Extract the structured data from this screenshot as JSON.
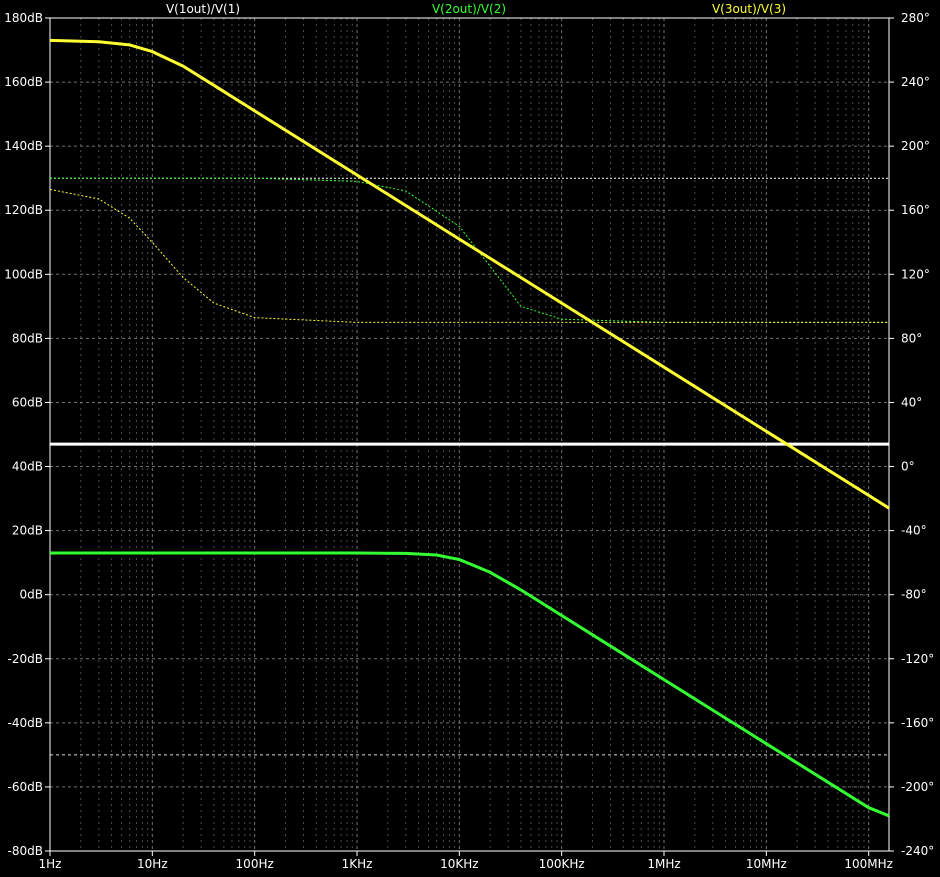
{
  "chart_data": {
    "type": "line",
    "x_scale": "log",
    "x_axis": {
      "range_hz": [
        1,
        158000000
      ],
      "ticks": [
        {
          "value": 1,
          "label": "1Hz"
        },
        {
          "value": 10,
          "label": "10Hz"
        },
        {
          "value": 100,
          "label": "100Hz"
        },
        {
          "value": 1000,
          "label": "1KHz"
        },
        {
          "value": 10000,
          "label": "10KHz"
        },
        {
          "value": 100000,
          "label": "100KHz"
        },
        {
          "value": 1000000,
          "label": "1MHz"
        },
        {
          "value": 10000000,
          "label": "10MHz"
        },
        {
          "value": 100000000,
          "label": "100MHz"
        }
      ]
    },
    "y_left": {
      "range": [
        -80,
        180
      ],
      "ticks": [
        {
          "value": 180,
          "label": "180dB"
        },
        {
          "value": 160,
          "label": "160dB"
        },
        {
          "value": 140,
          "label": "140dB"
        },
        {
          "value": 120,
          "label": "120dB"
        },
        {
          "value": 100,
          "label": "100dB"
        },
        {
          "value": 80,
          "label": "80dB"
        },
        {
          "value": 60,
          "label": "60dB"
        },
        {
          "value": 40,
          "label": "40dB"
        },
        {
          "value": 20,
          "label": "20dB"
        },
        {
          "value": 0,
          "label": "0dB"
        },
        {
          "value": -20,
          "label": "-20dB"
        },
        {
          "value": -40,
          "label": "-40dB"
        },
        {
          "value": -60,
          "label": "-60dB"
        },
        {
          "value": -80,
          "label": "-80dB"
        }
      ]
    },
    "y_right": {
      "range": [
        -240,
        280
      ],
      "ticks": [
        {
          "value": 280,
          "label": "280°"
        },
        {
          "value": 240,
          "label": "240°"
        },
        {
          "value": 200,
          "label": "200°"
        },
        {
          "value": 160,
          "label": "160°"
        },
        {
          "value": 120,
          "label": "120°"
        },
        {
          "value": 80,
          "label": "80°"
        },
        {
          "value": 40,
          "label": "40°"
        },
        {
          "value": 0,
          "label": "0°"
        },
        {
          "value": -40,
          "label": "-40°"
        },
        {
          "value": -80,
          "label": "-80°"
        },
        {
          "value": -120,
          "label": "-120°"
        },
        {
          "value": -160,
          "label": "-160°"
        },
        {
          "value": -200,
          "label": "-200°"
        },
        {
          "value": -240,
          "label": "-240°"
        }
      ]
    },
    "grid": true,
    "colors": {
      "background": "#000000",
      "grid": "#7f7f7f",
      "axis": "#ffffff",
      "trace1": "#ffffff",
      "trace2": "#33ff33",
      "trace3": "#ffff33"
    },
    "series": [
      {
        "name": "V(1out)/V(1)",
        "color": "#ffffff",
        "magnitude_db": [
          [
            1,
            47
          ],
          [
            158000000,
            47
          ]
        ],
        "phase_deg": [
          [
            1,
            180
          ],
          [
            158000000,
            180
          ]
        ]
      },
      {
        "name": "V(2out)/V(2)",
        "color": "#33ff33",
        "magnitude_db": [
          [
            1,
            13
          ],
          [
            1000,
            13
          ],
          [
            3000,
            12.9
          ],
          [
            6000,
            12.4
          ],
          [
            10000,
            11
          ],
          [
            20000,
            7
          ],
          [
            40000,
            1.5
          ],
          [
            100000,
            -6.5
          ],
          [
            1000000,
            -26.5
          ],
          [
            10000000,
            -46.5
          ],
          [
            100000000,
            -66.5
          ],
          [
            158000000,
            -69
          ]
        ],
        "phase_deg": [
          [
            1,
            180
          ],
          [
            100,
            180
          ],
          [
            1000,
            178
          ],
          [
            3000,
            172
          ],
          [
            10000,
            150
          ],
          [
            20000,
            125
          ],
          [
            40000,
            100
          ],
          [
            100000,
            92
          ],
          [
            1000000,
            90
          ],
          [
            158000000,
            90
          ]
        ]
      },
      {
        "name": "V(3out)/V(3)",
        "color": "#ffff33",
        "magnitude_db": [
          [
            1,
            173
          ],
          [
            3,
            172.6
          ],
          [
            6,
            171.6
          ],
          [
            10,
            169.5
          ],
          [
            20,
            165
          ],
          [
            40,
            159
          ],
          [
            100,
            151
          ],
          [
            1000,
            131
          ],
          [
            10000,
            111
          ],
          [
            100000,
            91
          ],
          [
            1000000,
            71
          ],
          [
            10000000,
            51
          ],
          [
            100000000,
            31
          ],
          [
            158000000,
            27
          ]
        ],
        "phase_deg": [
          [
            1,
            173
          ],
          [
            3,
            167
          ],
          [
            6,
            155
          ],
          [
            10,
            140
          ],
          [
            20,
            118
          ],
          [
            40,
            102
          ],
          [
            100,
            93
          ],
          [
            1000,
            90
          ],
          [
            158000000,
            90
          ]
        ]
      }
    ],
    "horizontal_marker_deg": -180
  }
}
